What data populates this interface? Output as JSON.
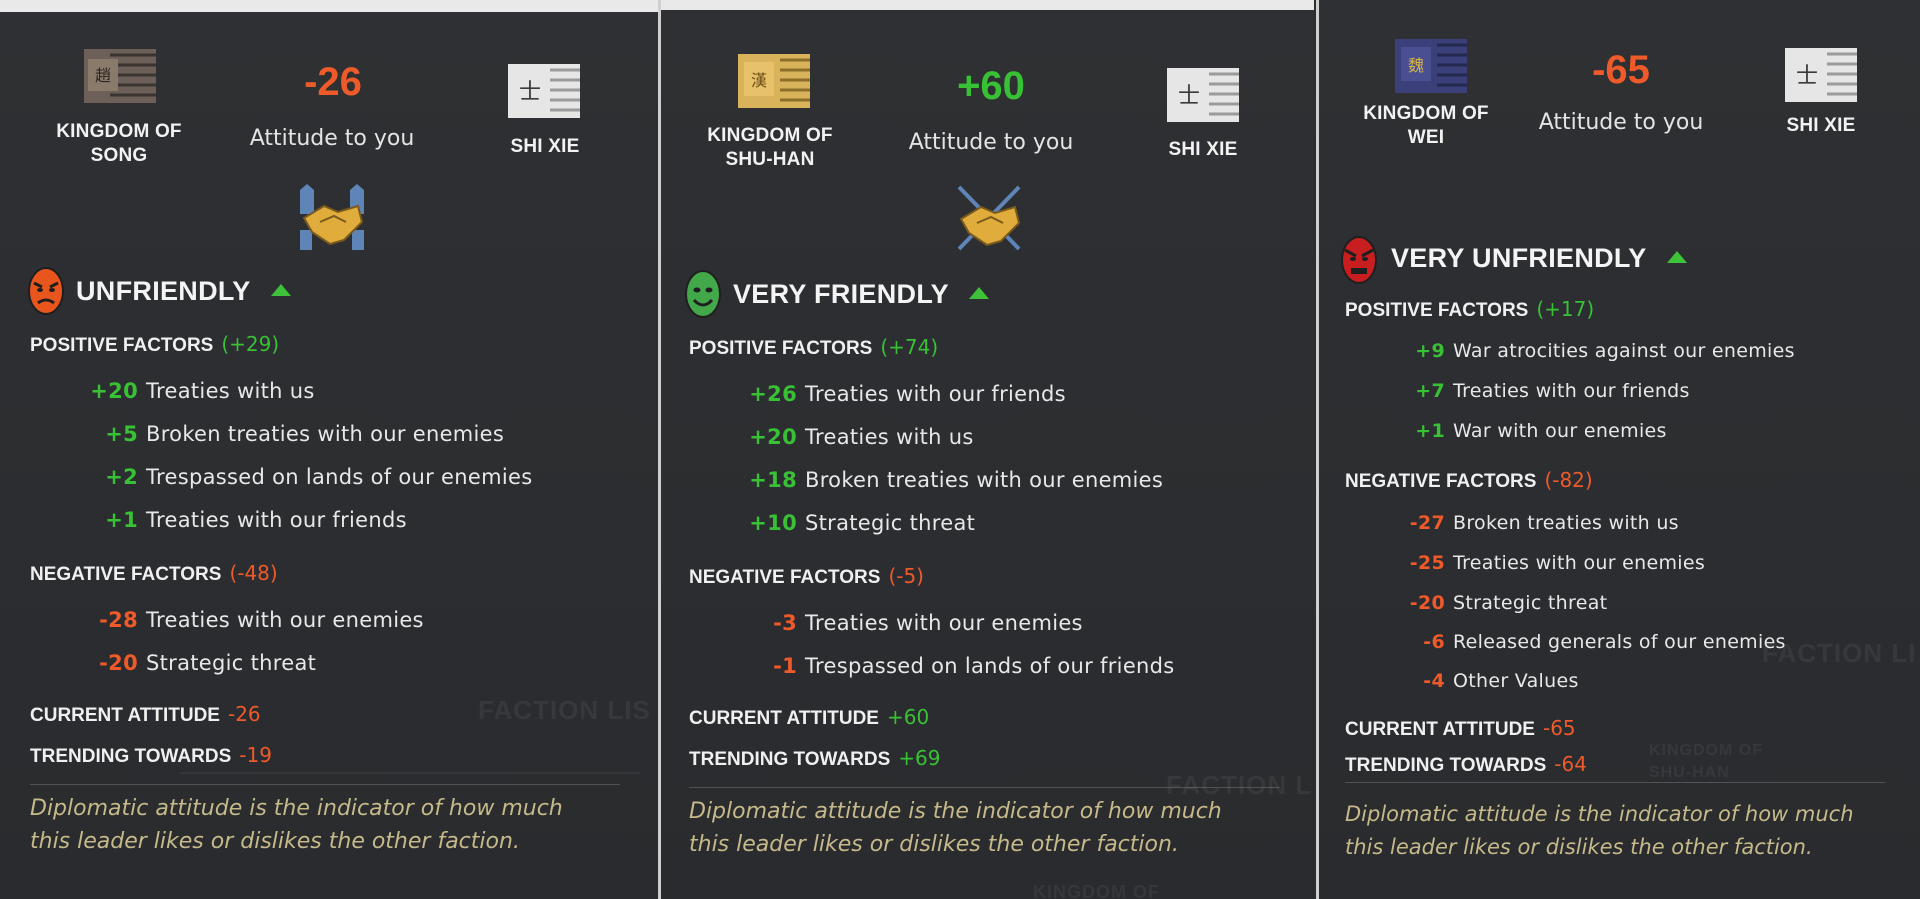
{
  "panels": [
    {
      "faction": "KINGDOM OF SONG",
      "faction_line1": "KINGDOM OF",
      "faction_line2": "SONG",
      "attitude_value": "-26",
      "attitude_label": "Attitude to you",
      "other_faction": "SHI XIE",
      "relation_level": "UNFRIENDLY",
      "positive_label": "POSITIVE FACTORS",
      "positive_total": "(+29)",
      "positive_factors": [
        {
          "value": "+20",
          "label": "Treaties with us"
        },
        {
          "value": "+5",
          "label": "Broken treaties with our enemies"
        },
        {
          "value": "+2",
          "label": "Trespassed on lands of our enemies"
        },
        {
          "value": "+1",
          "label": "Treaties with our friends"
        }
      ],
      "negative_label": "NEGATIVE FACTORS",
      "negative_total": "(-48)",
      "negative_factors": [
        {
          "value": "-28",
          "label": "Treaties with our enemies"
        },
        {
          "value": "-20",
          "label": "Strategic threat"
        }
      ],
      "current_label": "CURRENT ATTITUDE",
      "current_value": "-26",
      "trending_label": "TRENDING TOWARDS",
      "trending_value": "-19",
      "footer_line1": "Diplomatic attitude is the indicator of how much",
      "footer_line2": "this leader likes or dislikes the other faction.",
      "background_text": [
        "FACTION LIS"
      ]
    },
    {
      "faction": "KINGDOM OF SHU-HAN",
      "faction_line1": "KINGDOM OF",
      "faction_line2": "SHU-HAN",
      "attitude_value": "+60",
      "attitude_label": "Attitude to you",
      "other_faction": "SHI XIE",
      "relation_level": "VERY FRIENDLY",
      "positive_label": "POSITIVE FACTORS",
      "positive_total": "(+74)",
      "positive_factors": [
        {
          "value": "+26",
          "label": "Treaties with our friends"
        },
        {
          "value": "+20",
          "label": "Treaties with us"
        },
        {
          "value": "+18",
          "label": "Broken treaties with our enemies"
        },
        {
          "value": "+10",
          "label": "Strategic threat"
        }
      ],
      "negative_label": "NEGATIVE FACTORS",
      "negative_total": "(-5)",
      "negative_factors": [
        {
          "value": "-3",
          "label": "Treaties with our enemies"
        },
        {
          "value": "-1",
          "label": "Trespassed on lands of our friends"
        }
      ],
      "current_label": "CURRENT ATTITUDE",
      "current_value": "+60",
      "trending_label": "TRENDING TOWARDS",
      "trending_value": "+69",
      "footer_line1": "Diplomatic attitude is the indicator of how much",
      "footer_line2": "this leader likes or dislikes the other faction.",
      "background_text": [
        "FACTION L",
        "KINGDOM OF"
      ]
    },
    {
      "faction": "KINGDOM OF WEI",
      "faction_line1": "KINGDOM OF",
      "faction_line2": "WEI",
      "attitude_value": "-65",
      "attitude_label": "Attitude to you",
      "other_faction": "SHI XIE",
      "relation_level": "VERY UNFRIENDLY",
      "positive_label": "POSITIVE FACTORS",
      "positive_total": "(+17)",
      "positive_factors": [
        {
          "value": "+9",
          "label": "War atrocities against our enemies"
        },
        {
          "value": "+7",
          "label": "Treaties with our friends"
        },
        {
          "value": "+1",
          "label": "War with our enemies"
        }
      ],
      "negative_label": "NEGATIVE FACTORS",
      "negative_total": "(-82)",
      "negative_factors": [
        {
          "value": "-27",
          "label": "Broken treaties with us"
        },
        {
          "value": "-25",
          "label": "Treaties with our enemies"
        },
        {
          "value": "-20",
          "label": "Strategic threat"
        },
        {
          "value": "-6",
          "label": "Released generals of our enemies"
        },
        {
          "value": "-4",
          "label": "Other Values"
        }
      ],
      "current_label": "CURRENT ATTITUDE",
      "current_value": "-65",
      "trending_label": "TRENDING TOWARDS",
      "trending_value": "-64",
      "footer_line1": "Diplomatic attitude is the indicator of how much",
      "footer_line2": "this leader likes or dislikes the other faction.",
      "background_text": [
        "FACTION LI",
        "KINGDOM OF",
        "SHU-HAN"
      ]
    }
  ],
  "icons": {
    "faction_banner": "faction-banner-icon",
    "handshake": "handshake-icon",
    "mask": "relation-mask-icon",
    "trend_arrow": "trend-up-arrow-icon"
  },
  "colors": {
    "positive": "#39c136",
    "negative": "#ee5a2a",
    "footer": "#c6b98a",
    "unfriendly_mask": "#e8561e",
    "very_friendly_mask": "#43a84a",
    "very_unfriendly_mask": "#c81e20"
  }
}
